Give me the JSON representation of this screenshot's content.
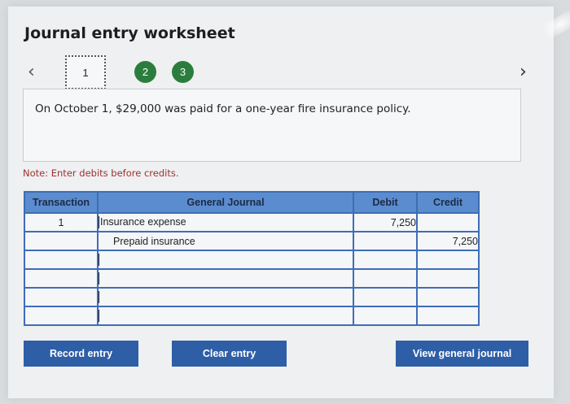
{
  "header": {
    "title": "Journal entry worksheet"
  },
  "steps": {
    "prev_icon": "chevron-left-icon",
    "next_icon": "chevron-right-icon",
    "items": [
      {
        "label": "1",
        "state": "current"
      },
      {
        "label": "2",
        "state": "completed"
      },
      {
        "label": "3",
        "state": "completed"
      }
    ],
    "completed_color": "#2b7d3d"
  },
  "scenario": {
    "text": "On October 1, $29,000 was paid for a one-year fire insurance policy."
  },
  "note": {
    "text": "Note: Enter debits before credits."
  },
  "journal": {
    "headers": {
      "transaction": "Transaction",
      "general_journal": "General Journal",
      "debit": "Debit",
      "credit": "Credit"
    },
    "rows": [
      {
        "transaction": "1",
        "account": "Insurance expense",
        "debit": "7,250",
        "credit": ""
      },
      {
        "transaction": "",
        "account": "Prepaid insurance",
        "debit": "",
        "credit": "7,250"
      },
      {
        "transaction": "",
        "account": "",
        "debit": "",
        "credit": ""
      },
      {
        "transaction": "",
        "account": "",
        "debit": "",
        "credit": ""
      },
      {
        "transaction": "",
        "account": "",
        "debit": "",
        "credit": ""
      },
      {
        "transaction": "",
        "account": "",
        "debit": "",
        "credit": ""
      }
    ],
    "header_color": "#5b8cd0"
  },
  "buttons": {
    "record": "Record entry",
    "clear": "Clear entry",
    "view": "View general journal",
    "color": "#2e5ea6"
  }
}
